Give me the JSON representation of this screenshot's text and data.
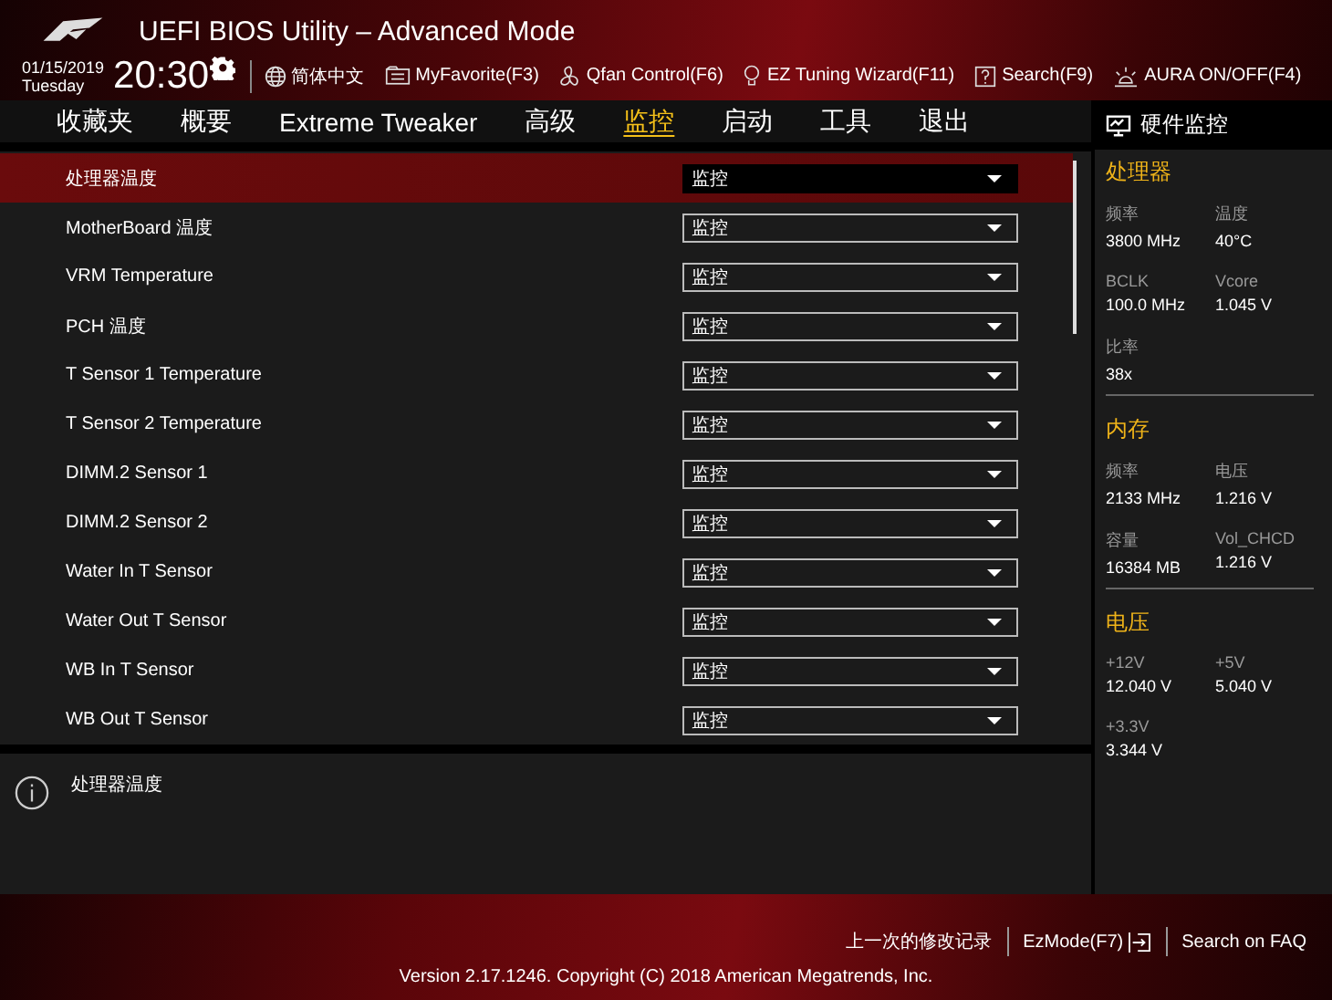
{
  "header": {
    "title": "UEFI BIOS Utility – Advanced Mode",
    "date": "01/15/2019",
    "day": "Tuesday",
    "time": "20:30",
    "tools": [
      {
        "label": "简体中文",
        "kind": "globe"
      },
      {
        "label": "MyFavorite(F3)",
        "kind": "favorite"
      },
      {
        "label": "Qfan Control(F6)",
        "kind": "fan"
      },
      {
        "label": "EZ Tuning Wizard(F11)",
        "kind": "bulb"
      },
      {
        "label": "Search(F9)",
        "kind": "search"
      },
      {
        "label": "AURA ON/OFF(F4)",
        "kind": "aura"
      }
    ]
  },
  "tabs": [
    {
      "label": "收藏夹",
      "selected": false
    },
    {
      "label": "概要",
      "selected": false
    },
    {
      "label": "Extreme Tweaker",
      "selected": false
    },
    {
      "label": "高级",
      "selected": false
    },
    {
      "label": "监控",
      "selected": true
    },
    {
      "label": "启动",
      "selected": false
    },
    {
      "label": "工具",
      "selected": false
    },
    {
      "label": "退出",
      "selected": false
    }
  ],
  "settings": [
    {
      "label": "处理器温度",
      "value": "监控",
      "selected": true
    },
    {
      "label": "MotherBoard 温度",
      "value": "监控",
      "selected": false
    },
    {
      "label": "VRM Temperature",
      "value": "监控",
      "selected": false
    },
    {
      "label": "PCH 温度",
      "value": "监控",
      "selected": false
    },
    {
      "label": "T Sensor 1 Temperature",
      "value": "监控",
      "selected": false
    },
    {
      "label": "T Sensor 2 Temperature",
      "value": "监控",
      "selected": false
    },
    {
      "label": "DIMM.2 Sensor 1",
      "value": "监控",
      "selected": false
    },
    {
      "label": "DIMM.2 Sensor 2",
      "value": "监控",
      "selected": false
    },
    {
      "label": "Water In T Sensor",
      "value": "监控",
      "selected": false
    },
    {
      "label": "Water Out T Sensor",
      "value": "监控",
      "selected": false
    },
    {
      "label": "WB In T Sensor",
      "value": "监控",
      "selected": false
    },
    {
      "label": "WB Out T Sensor",
      "value": "监控",
      "selected": false
    }
  ],
  "help": {
    "text": "处理器温度"
  },
  "hardware_monitor": {
    "title": "硬件监控",
    "sections": [
      {
        "title": "处理器",
        "items": [
          {
            "label": "频率",
            "value": "3800 MHz"
          },
          {
            "label": "温度",
            "value": "40°C"
          },
          {
            "label": "BCLK",
            "value": "100.0 MHz"
          },
          {
            "label": "Vcore",
            "value": "1.045 V"
          },
          {
            "label": "比率",
            "value": "38x"
          }
        ]
      },
      {
        "title": "内存",
        "items": [
          {
            "label": "频率",
            "value": "2133 MHz"
          },
          {
            "label": "电压",
            "value": "1.216 V"
          },
          {
            "label": "容量",
            "value": "16384 MB"
          },
          {
            "label": "Vol_CHCD",
            "value": "1.216 V"
          }
        ]
      },
      {
        "title": "电压",
        "items": [
          {
            "label": "+12V",
            "value": "12.040 V"
          },
          {
            "label": "+5V",
            "value": "5.040 V"
          },
          {
            "label": "+3.3V",
            "value": "3.344 V"
          }
        ]
      }
    ]
  },
  "footer": {
    "links": [
      {
        "label": "上一次的修改记录",
        "kind": "text"
      },
      {
        "label": "EzMode(F7)",
        "kind": "mode"
      },
      {
        "label": "Search on FAQ",
        "kind": "text"
      }
    ],
    "copyright": "Version 2.17.1246. Copyright (C) 2018 American Megatrends, Inc."
  }
}
